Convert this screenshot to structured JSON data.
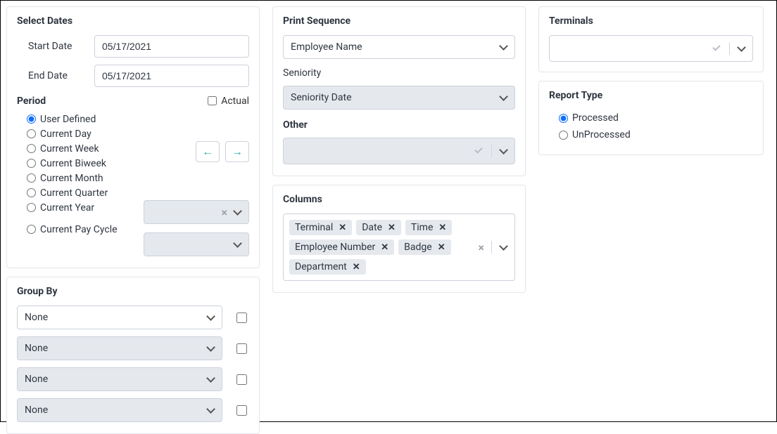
{
  "selectDates": {
    "title": "Select Dates",
    "startLabel": "Start Date",
    "startValue": "05/17/2021",
    "endLabel": "End Date",
    "endValue": "05/17/2021"
  },
  "period": {
    "title": "Period",
    "actualLabel": "Actual",
    "options": {
      "userDefined": "User Defined",
      "currentDay": "Current Day",
      "currentWeek": "Current Week",
      "currentBiweek": "Current Biweek",
      "currentMonth": "Current Month",
      "currentQuarter": "Current Quarter",
      "currentYear": "Current Year",
      "currentPayCycle": "Current Pay Cycle"
    },
    "selected": "userDefined"
  },
  "groupBy": {
    "title": "Group By",
    "rows": {
      "r1": "None",
      "r2": "None",
      "r3": "None",
      "r4": "None"
    }
  },
  "printSequence": {
    "title": "Print Sequence",
    "value": "Employee Name",
    "seniorityLabel": "Seniority",
    "seniorityValue": "Seniority Date",
    "otherLabel": "Other"
  },
  "columns": {
    "title": "Columns",
    "tags": {
      "t1": "Terminal",
      "t2": "Date",
      "t3": "Time",
      "t4": "Employee Number",
      "t5": "Badge",
      "t6": "Department"
    }
  },
  "terminals": {
    "title": "Terminals"
  },
  "reportType": {
    "title": "Report Type",
    "processed": "Processed",
    "unprocessed": "UnProcessed",
    "selected": "processed"
  }
}
